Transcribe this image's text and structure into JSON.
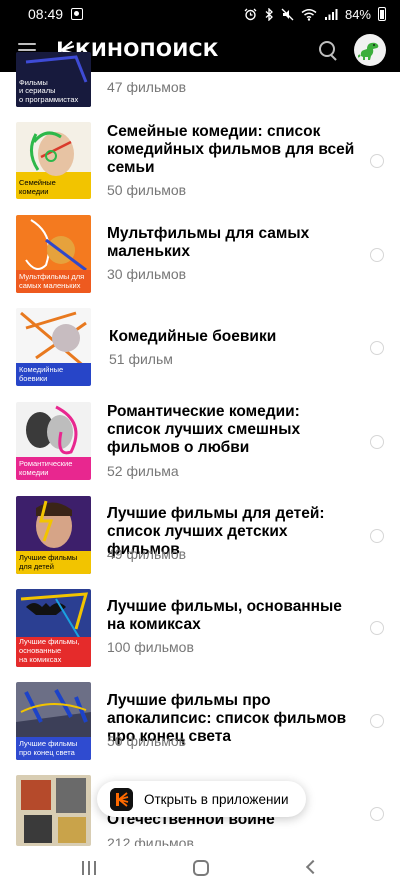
{
  "status_bar": {
    "time": "08:49",
    "battery": "84%"
  },
  "header": {
    "logo_text": "КИНОПОИСК"
  },
  "items": [
    {
      "title": "",
      "count": "47 фильмов",
      "cover_label": "Фильмы\nи сериалы\nо программистах"
    },
    {
      "title": "Семейные комедии: список комедийных фильмов для всей семьи",
      "count": "50 фильмов",
      "cover_label": "Семейные\nкомедии"
    },
    {
      "title": "Мультфильмы для самых маленьких",
      "count": "30 фильмов",
      "cover_label": "Мультфильмы для\nсамых маленьких"
    },
    {
      "title": "Комедийные боевики",
      "count": "51 фильм",
      "cover_label": "Комедийные\nбоевики"
    },
    {
      "title": "Романтические комедии: список лучших смешных фильмов о любви",
      "count": "52 фильма",
      "cover_label": "Романтические\nкомедии"
    },
    {
      "title": "Лучшие фильмы для детей: список лучших детских фильмов",
      "count": "49 фильмов",
      "cover_label": "Лучшие фильмы\nдля детей"
    },
    {
      "title": "Лучшие фильмы, основанные на комиксах",
      "count": "100 фильмов",
      "cover_label": "Лучшие фильмы,\nоснованные\nна комиксах"
    },
    {
      "title": "Лучшие фильмы про апокалипсис: список фильмов про конец света",
      "count": "50 фильмов",
      "cover_label": "Лучшие фильмы\nпро конец света"
    },
    {
      "title": "Отечественной войне",
      "count": "212 фильмов",
      "cover_label": ""
    }
  ],
  "open_app": {
    "label": "Открыть в приложении"
  },
  "colors": {
    "accent": "#ff5500",
    "header_bg": "#000000"
  }
}
